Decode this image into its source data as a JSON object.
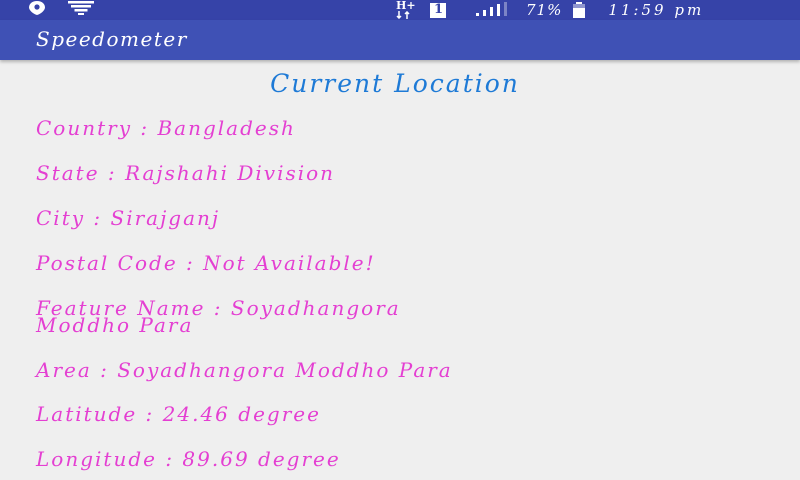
{
  "status_bar": {
    "battery_percent": "71%",
    "time": "11:59 pm",
    "network_label": "H+",
    "sim_slot": "1",
    "icons": [
      "location-icon",
      "wifi-icon",
      "network-type-icon",
      "sim-icon",
      "signal-icon",
      "battery-icon"
    ]
  },
  "app_bar": {
    "title": "Speedometer"
  },
  "main": {
    "heading": "Current Location",
    "fields": {
      "country": "Country : Bangladesh",
      "state": "State : Rajshahi Division",
      "city": "City : Sirajganj",
      "postal_code": "Postal Code : Not Available!",
      "feature_name_line1": "Feature Name : Soyadhangora",
      "feature_name_line2": "Moddho Para",
      "area": "Area : Soyadhangora Moddho Para",
      "latitude": "Latitude : 24.46 degree",
      "longitude": "Longitude : 89.69 degree"
    }
  },
  "colors": {
    "status_bar": "#3643a8",
    "app_bar": "#3f51b5",
    "background": "#efefef",
    "heading": "#1e7ad6",
    "field_text": "#e43fd2"
  }
}
